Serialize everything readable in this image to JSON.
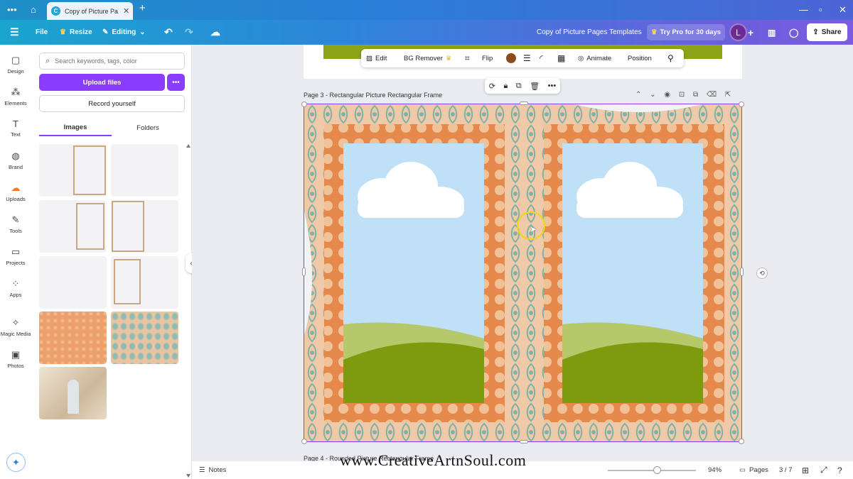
{
  "browser": {
    "tab_title": "Copy of Picture Pa...",
    "favicon_letter": "C",
    "icons": [
      "menu-dots-icon",
      "home-icon",
      "close-icon",
      "plus-icon",
      "minimize-icon",
      "restore-icon",
      "close-window-icon"
    ]
  },
  "toolbar": {
    "file": "File",
    "resize": "Resize",
    "editing": "Editing",
    "doc_title": "Copy of Picture Pages Templates",
    "try_pro": "Try Pro for 30 days",
    "avatar_letter": "L",
    "share": "Share"
  },
  "rail": {
    "items": [
      {
        "label": "Design",
        "glyph": "▢"
      },
      {
        "label": "Elements",
        "glyph": "⁂"
      },
      {
        "label": "Text",
        "glyph": "T"
      },
      {
        "label": "Brand",
        "glyph": "◍"
      },
      {
        "label": "Uploads",
        "glyph": "☁"
      },
      {
        "label": "Tools",
        "glyph": "✎"
      },
      {
        "label": "Projects",
        "glyph": "▭"
      },
      {
        "label": "Apps",
        "glyph": "⁘"
      },
      {
        "label": "Magic Media",
        "glyph": "✧"
      },
      {
        "label": "Photos",
        "glyph": "▣"
      }
    ]
  },
  "panel": {
    "search_placeholder": "Search keywords, tags, color",
    "upload": "Upload files",
    "upload_more": "•••",
    "record": "Record yourself",
    "tabs": [
      "Images",
      "Folders"
    ]
  },
  "context_toolbar": {
    "edit": "Edit",
    "bg_remover": "BG Remover",
    "flip": "Flip",
    "animate": "Animate",
    "position": "Position",
    "color": "#8a4b1f"
  },
  "canvas": {
    "page3_title": "Page 3 - Rectangular Picture Rectangular Frame",
    "page4_title": "Page 4 - Rounded Picture Rectangular Frame",
    "colors": {
      "sky": "#bfe0f6",
      "grass_light": "#b6c96a",
      "grass_dark": "#7e9a0f",
      "frame": "#e58a4c",
      "damask": "#7fb2a8"
    }
  },
  "bottom": {
    "notes": "Notes",
    "zoom": "94%",
    "pages": "Pages",
    "page_counter": "3 / 7"
  },
  "watermark": "www.CreativeArtnSoul.com"
}
